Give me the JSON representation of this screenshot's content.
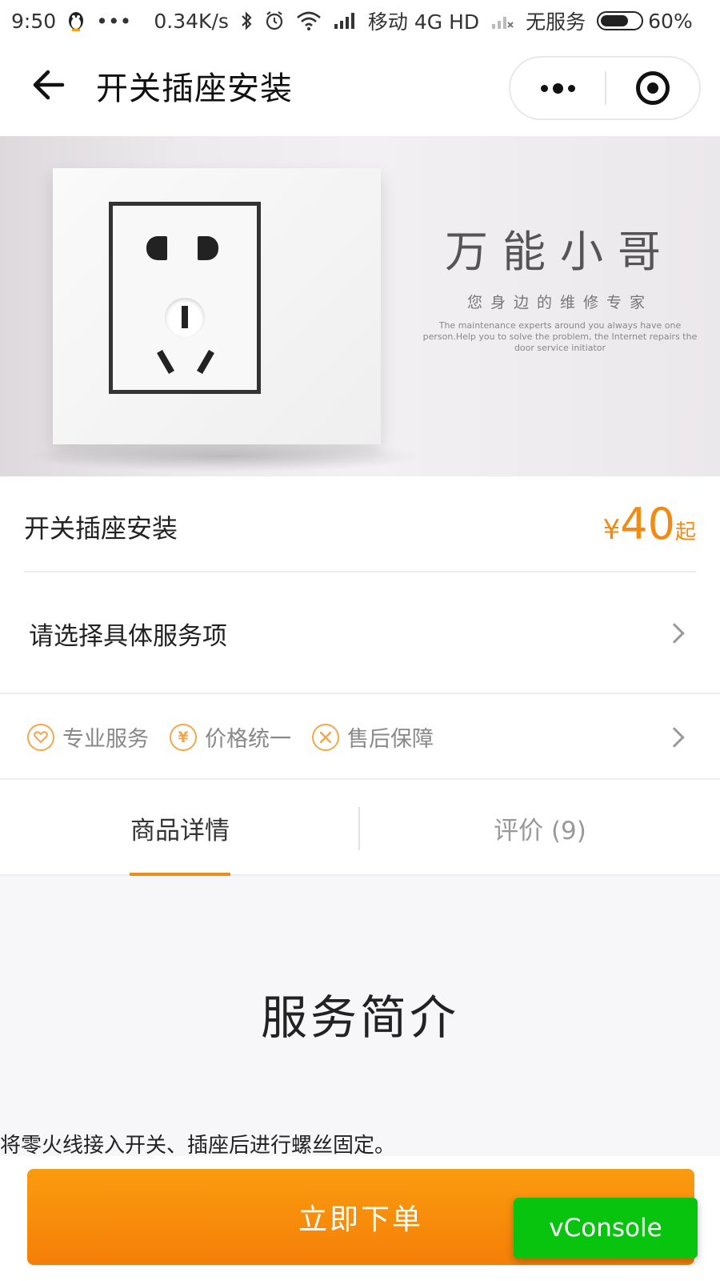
{
  "status_bar": {
    "time": "9:50",
    "qq_icon": "penguin-icon",
    "dots": "•••",
    "speed": "0.34K/s",
    "carrier": "移动 4G HD",
    "no_service": "无服务",
    "battery": "60%"
  },
  "nav": {
    "title": "开关插座安装"
  },
  "banner": {
    "brand_title": "万能小哥",
    "brand_subtitle": "您身边的维修专家",
    "brand_english": "The maintenance experts around you always have one person.Help you to solve the problem, the Internet repairs the door service initiator"
  },
  "product": {
    "name": "开关插座安装",
    "price_currency": "¥",
    "price_value": "40",
    "price_suffix": "起"
  },
  "select_service": {
    "label": "请选择具体服务项"
  },
  "guarantees": [
    {
      "label": "专业服务",
      "icon": "heart-icon"
    },
    {
      "label": "价格统一",
      "icon": "yen-icon"
    },
    {
      "label": "售后保障",
      "icon": "tools-icon"
    }
  ],
  "tabs": [
    {
      "label": "商品详情",
      "active": true
    },
    {
      "label": "评价 (9)",
      "active": false
    }
  ],
  "content": {
    "title": "服务简介",
    "text": "将零火线接入开关、插座后进行螺丝固定。"
  },
  "order_button": {
    "label": "立即下单"
  },
  "vconsole": {
    "label": "vConsole"
  },
  "colors": {
    "accent": "#f28a13",
    "vconsole": "#09c40f"
  }
}
